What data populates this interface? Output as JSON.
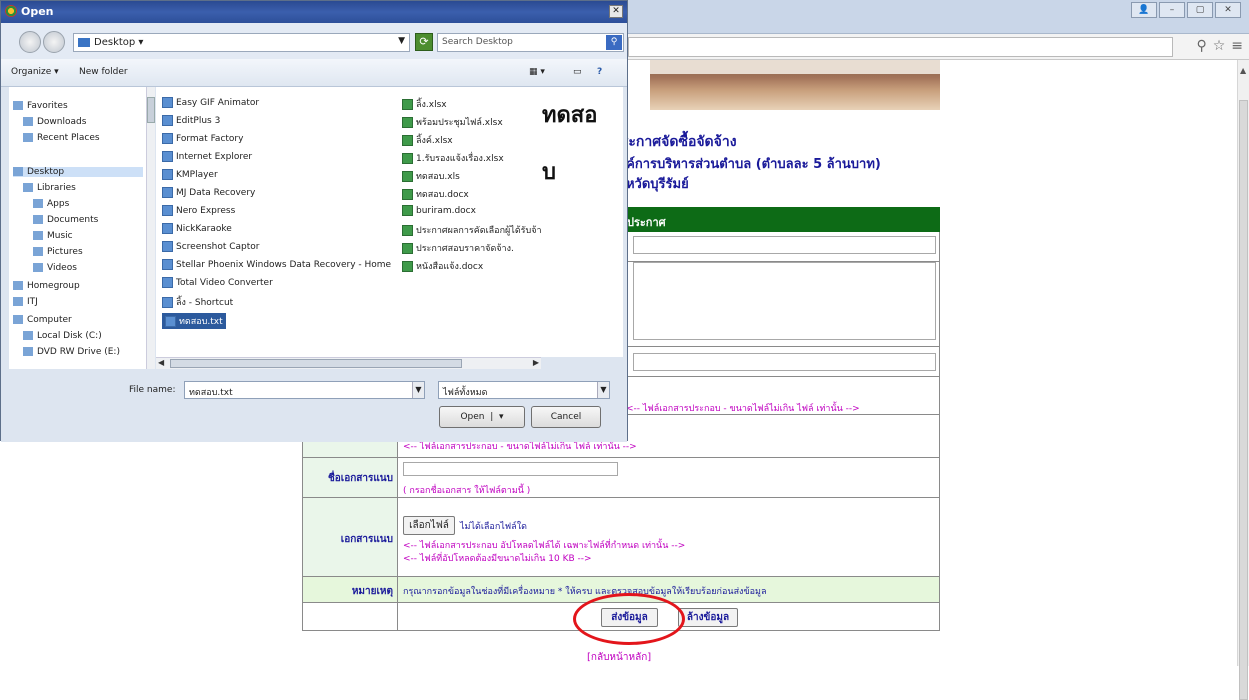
{
  "dialog": {
    "title": "Open",
    "close_label": "✕",
    "path": "Desktop",
    "search_placeholder": "Search Desktop",
    "toolbar": {
      "organize": "Organize ▾",
      "new_folder": "New folder"
    },
    "nav_tree": [
      {
        "label": "Favorites",
        "icon": "star-icon"
      },
      {
        "label": "Downloads",
        "icon": "download-folder-icon"
      },
      {
        "label": "Recent Places",
        "icon": "recent-places-icon"
      },
      {
        "label": "Desktop",
        "icon": "desktop-icon"
      },
      {
        "label": "Libraries",
        "icon": "libraries-icon"
      },
      {
        "label": "Apps",
        "icon": "folder-icon"
      },
      {
        "label": "Documents",
        "icon": "documents-icon"
      },
      {
        "label": "Music",
        "icon": "music-icon"
      },
      {
        "label": "Pictures",
        "icon": "pictures-icon"
      },
      {
        "label": "Videos",
        "icon": "videos-icon"
      },
      {
        "label": "Homegroup",
        "icon": "homegroup-icon"
      },
      {
        "label": "ITJ",
        "icon": "user-folder-icon"
      },
      {
        "label": "Computer",
        "icon": "computer-icon"
      },
      {
        "label": "Local Disk (C:)",
        "icon": "disk-icon"
      },
      {
        "label": "DVD RW Drive (E:)",
        "icon": "dvd-icon"
      }
    ],
    "files_col1": [
      "Easy GIF Animator",
      "EditPlus 3",
      "Format Factory",
      "Internet Explorer",
      "KMPlayer",
      "MJ Data Recovery",
      "Nero Express",
      "NickKaraoke",
      "Screenshot Captor",
      "Stellar Phoenix Windows Data Recovery - Home",
      "Total Video Converter",
      "ลิ้ง - Shortcut",
      "ทดสอบ.txt"
    ],
    "files_col2": [
      "ลิ้ง.xlsx",
      "พร้อมประชุมไฟล์.xlsx",
      "ลิ้งค์.xlsx",
      "1.รับรองแจ้งเรื่อง.xlsx",
      "ทดสอบ.xls",
      "ทดสอบ.docx",
      "buriram.docx",
      "ประกาศผลการคัดเลือกผู้ได้รับจ้าง.",
      "ประกาศสอบราคาจัดจ้าง.",
      "หนังสือแจ้ง.docx"
    ],
    "preview_text_1": "ทดสอ",
    "preview_text_2": "บ",
    "file_name_label": "File name:",
    "file_name_value": "ทดสอบ.txt",
    "file_type_value": "ไฟล์ทั้งหมด",
    "open_label": "Open",
    "cancel_label": "Cancel"
  },
  "page": {
    "heading_1": "ประกาศจัดซื้อจัดจ้าง",
    "heading_2": "องค์การบริหารส่วนตำบล (ตำบลละ 5 ล้านบาท)",
    "heading_3": "จังหวัดบุรีรัมย์",
    "form_header": "ประกาศ",
    "file_hint_1": "<-- ไฟล์เอกสารประกอบ - ขนาดไฟล์ไม่เกิน ไฟล์ เท่านั้น -->",
    "file_hint_2": "<-- ไฟล์เอกสารประกอบ - ขนาดไฟล์ไม่เกิน ไฟล์ เท่านั้น -->",
    "attach_label": "ชื่อเอกสารแนบ",
    "attach_hint": "( กรอกชื่อเอกสาร ให้ไฟล์ตามนี้ )",
    "doc_label": "เอกสารแนบ",
    "choose_file_label": "เลือกไฟล์",
    "no_file_label": "ไม่ได้เลือกไฟล์ใด",
    "doc_hint_1": "<-- ไฟล์เอกสารประกอบ อัปโหลดไฟล์ได้ เฉพาะไฟล์ที่กำหนด เท่านั้น -->",
    "doc_hint_2": "<-- ไฟล์ที่อัปโหลดต้องมีขนาดไม่เกิน 10 KB -->",
    "note_label": "หมายเหตุ",
    "note_text": "กรุณากรอกข้อมูลในช่องที่มีเครื่องหมาย * ให้ครบ และตรวจสอบข้อมูลให้เรียบร้อยก่อนส่งข้อมูล",
    "submit_label": "ส่งข้อมูล",
    "reset_label": "ล้างข้อมูล",
    "back_link": "[กลับหน้าหลัก]"
  },
  "annotation": {
    "circle_color": "#e3151b"
  },
  "colors": {
    "form_header_bg": "#0d6b16",
    "label_cell_bg": "#eaf6ea",
    "hint_text": "#c000c0",
    "heading_text": "#1a1a9a"
  }
}
